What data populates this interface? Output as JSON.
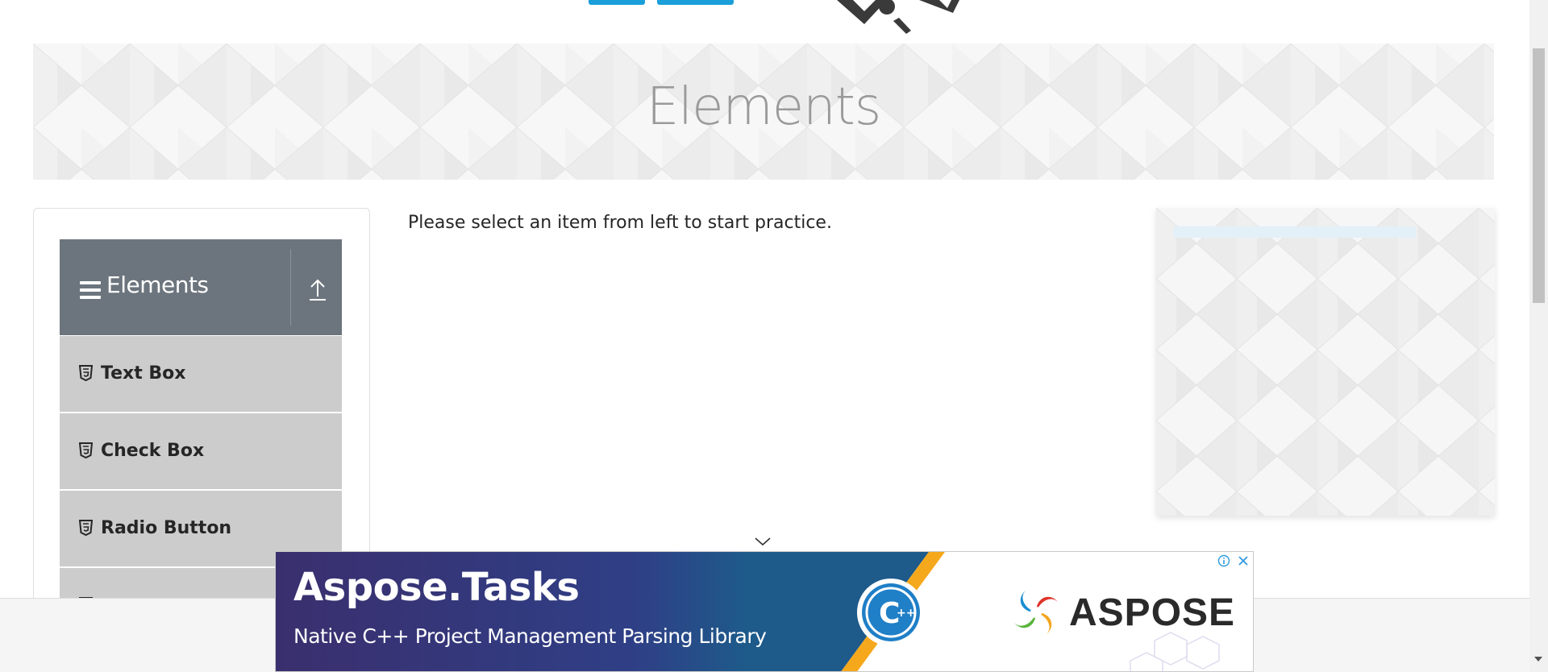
{
  "banner": {
    "title": "Elements"
  },
  "sidebar": {
    "group_title": "Elements",
    "group_icon": "hamburger-icon",
    "collapse_icon": "upload-arrow-icon",
    "items": [
      {
        "label": "Text Box",
        "icon": "html5-icon"
      },
      {
        "label": "Check Box",
        "icon": "html5-icon"
      },
      {
        "label": "Radio Button",
        "icon": "html5-icon"
      }
    ]
  },
  "main": {
    "instruction": "Please select an item from left to start practice."
  },
  "ad": {
    "title": "Aspose.Tasks",
    "subtitle": "Native C++ Project Management Parsing Library",
    "brand": "ASPOSE",
    "badge": "C++",
    "controls": [
      "info-icon",
      "close-icon"
    ],
    "colors": {
      "left_bg": "#3b2d6b",
      "right_bg": "#ffffff",
      "accent": "#f6a81c"
    }
  },
  "colors": {
    "sidebar_header": "#6c757d",
    "sidebar_item": "#cccccc",
    "banner_title": "#9a9a9a"
  }
}
